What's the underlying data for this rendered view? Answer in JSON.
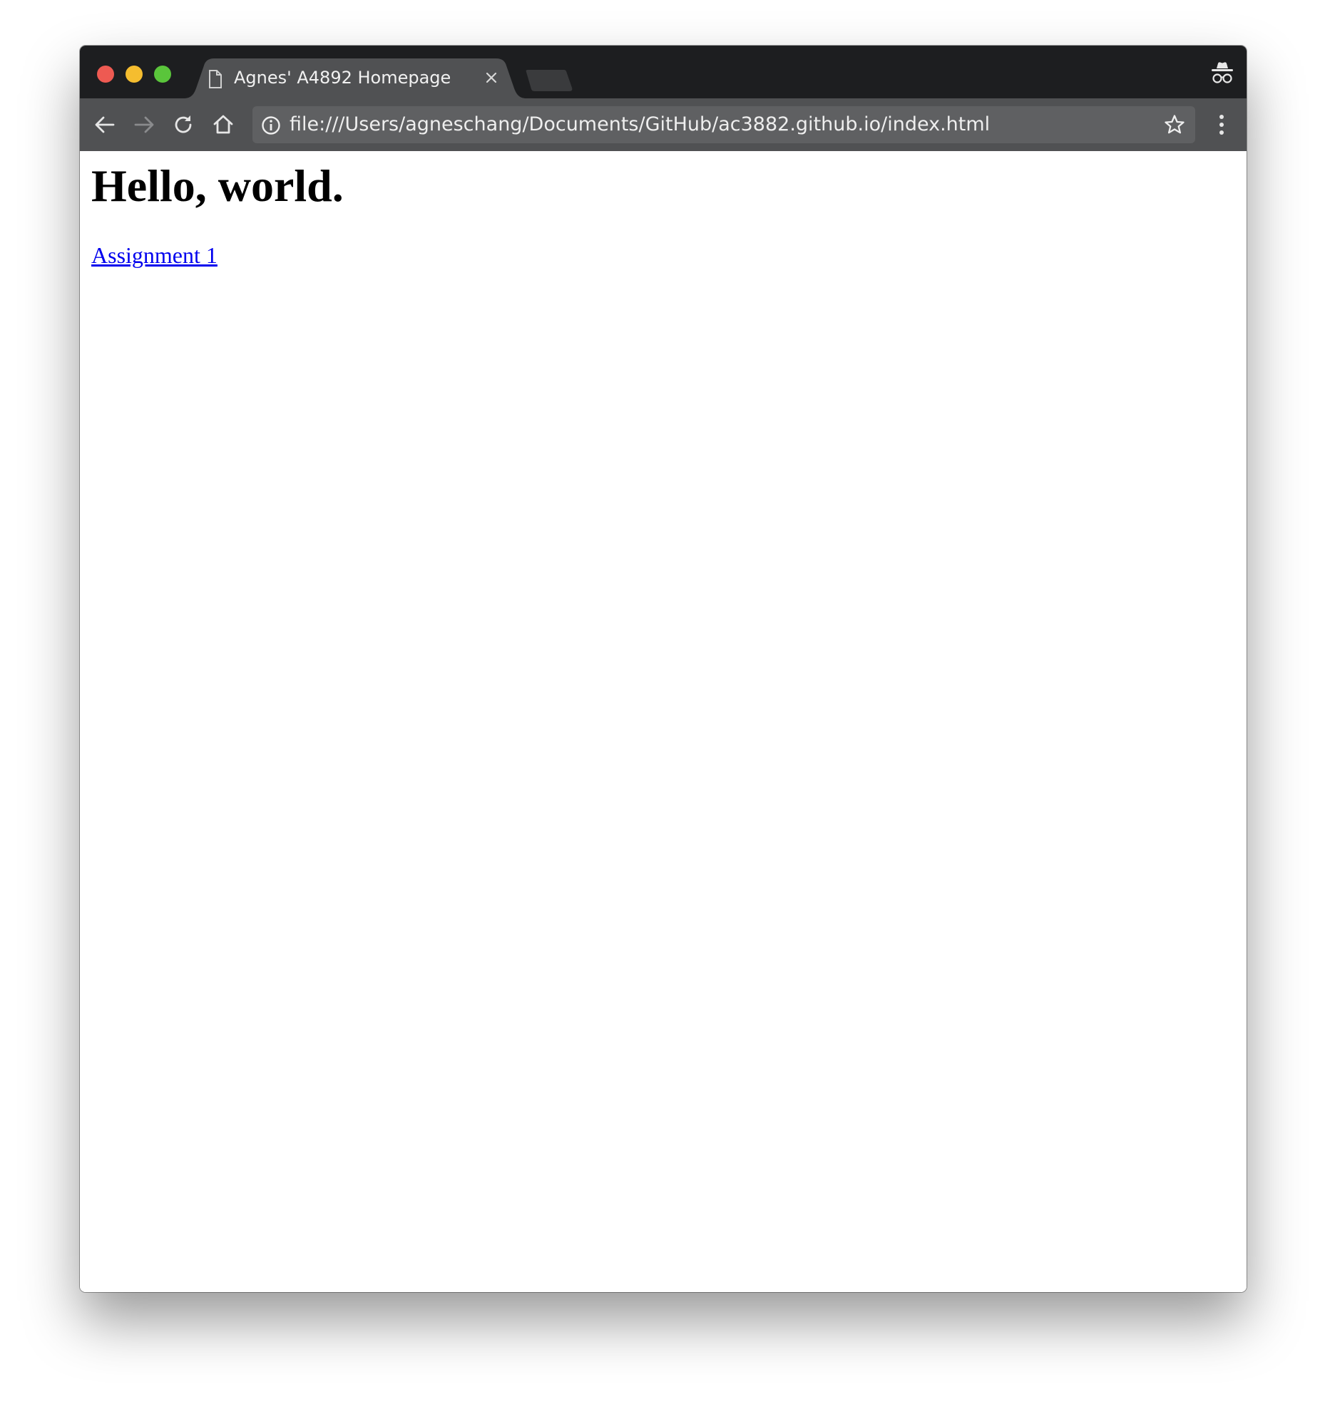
{
  "browser": {
    "tab": {
      "title": "Agnes' A4892 Homepage",
      "icon": "page-icon",
      "close_icon": "close-icon"
    },
    "new_tab_icon": "new-tab-icon",
    "profile_icon": "incognito-icon",
    "toolbar": {
      "back_icon": "back-arrow-icon",
      "forward_icon": "forward-arrow-icon",
      "reload_icon": "reload-icon",
      "home_icon": "home-icon",
      "menu_icon": "more-vertical-icon"
    },
    "omnibox": {
      "info_icon": "info-icon",
      "url": "file:///Users/agneschang/Documents/GitHub/ac3882.github.io/index.html",
      "bookmark_icon": "star-icon"
    },
    "colors": {
      "tabstrip": "#1d1e20",
      "toolbar": "#505153",
      "active_tab": "#505153",
      "omnibox": "#5f6062",
      "close_red": "#ee5a52",
      "minimize_yellow": "#f5bd2f",
      "zoom_green": "#5ac53b"
    }
  },
  "page": {
    "heading": "Hello, world.",
    "link_label": "Assignment 1",
    "colors": {
      "link": "#0000ee",
      "text": "#000000",
      "background": "#ffffff"
    }
  }
}
